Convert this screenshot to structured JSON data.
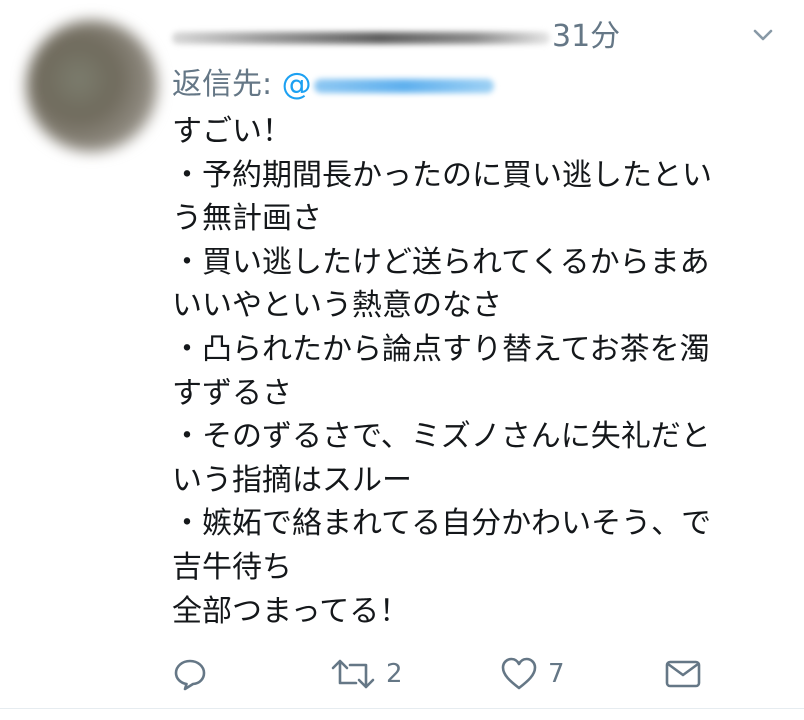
{
  "tweet": {
    "time": "31分",
    "reply_prefix": "返信先: ",
    "reply_at": "@",
    "lines": [
      "すごい！",
      "・予約期間長かったのに買い逃したとい",
      "う無計画さ",
      "・買い逃したけど送られてくるからまあ",
      "いいやという熱意のなさ",
      "・凸られたから論点すり替えてお茶を濁",
      "すずるさ",
      "・そのずるさで、ミズノさんに失礼だと",
      "いう指摘はスルー",
      "・嫉妬で絡まれてる自分かわいそう、で",
      "吉牛待ち",
      "全部つまってる！"
    ]
  },
  "actions": {
    "reply": {
      "icon": "reply-icon"
    },
    "retweet": {
      "icon": "retweet-icon",
      "count": "2"
    },
    "like": {
      "icon": "heart-icon",
      "count": "7"
    },
    "dm": {
      "icon": "mail-icon"
    }
  },
  "colors": {
    "text": "#14171a",
    "secondary": "#657786",
    "accent": "#1da1f2"
  }
}
